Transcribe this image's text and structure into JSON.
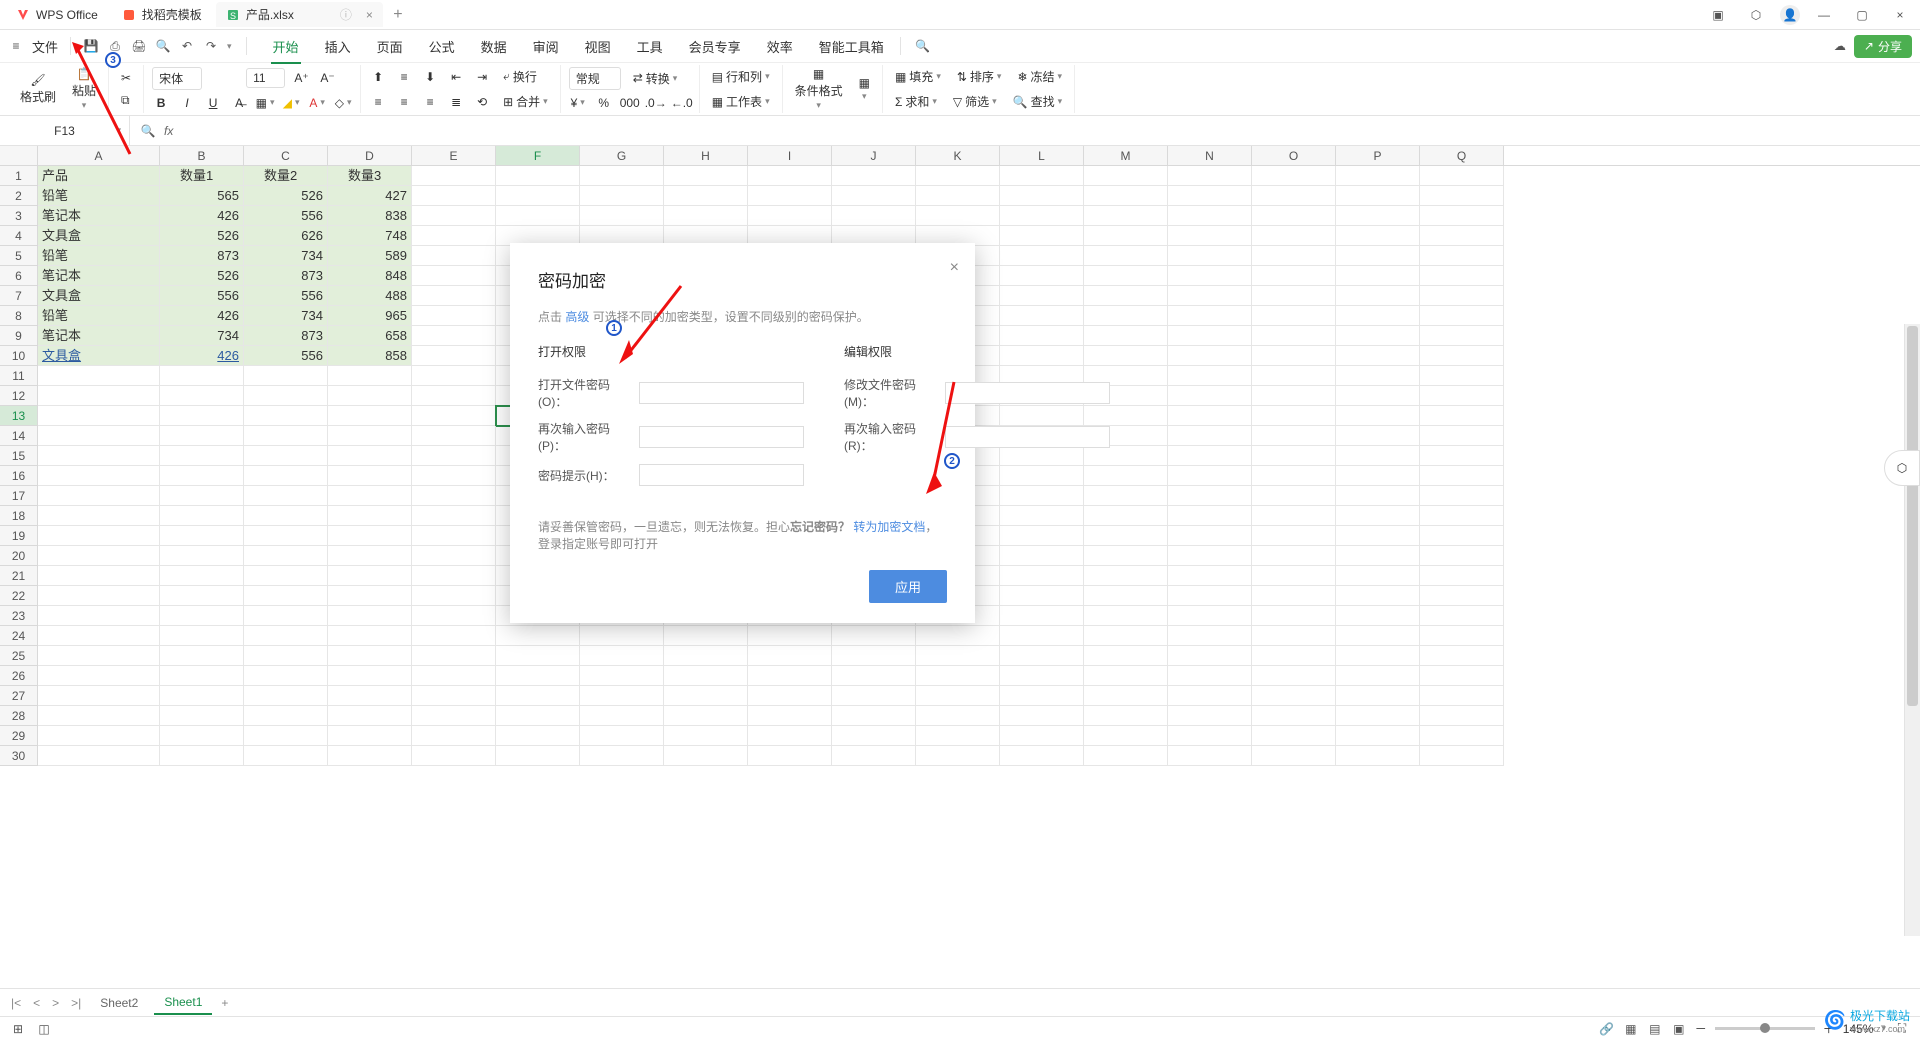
{
  "title_tabs": [
    {
      "icon_color": "#ff4d4d",
      "label": "WPS Office"
    },
    {
      "icon_color": "#ff5a3c",
      "label": "找稻壳模板"
    },
    {
      "icon_color": "#3cb371",
      "label": "产品.xlsx"
    }
  ],
  "quick": {
    "file": "文件"
  },
  "menu": [
    "开始",
    "插入",
    "页面",
    "公式",
    "数据",
    "审阅",
    "视图",
    "工具",
    "会员专享",
    "效率",
    "智能工具箱"
  ],
  "ribbon": {
    "format_brush": "格式刷",
    "paste": "粘贴",
    "font_name": "宋体",
    "font_size": "11",
    "wrap": "换行",
    "general": "常规",
    "convert": "转换",
    "rowcol": "行和列",
    "worksheet": "工作表",
    "cond_format": "条件格式",
    "fill": "填充",
    "sort": "排序",
    "freeze": "冻结",
    "sum": "求和",
    "filter": "筛选",
    "find": "查找",
    "merge": "合并"
  },
  "share_btn": "分享",
  "name_box": "F13",
  "fx": "fx",
  "columns": [
    "A",
    "B",
    "C",
    "D",
    "E",
    "F",
    "G",
    "H",
    "I",
    "J",
    "K",
    "L",
    "M",
    "N",
    "O",
    "P",
    "Q"
  ],
  "data_rows": [
    {
      "r": 1,
      "cells": [
        "产品",
        "数量1",
        "数量2",
        "数量3"
      ],
      "hl": true,
      "header": true
    },
    {
      "r": 2,
      "cells": [
        "铅笔",
        "565",
        "526",
        "427"
      ],
      "hl": true
    },
    {
      "r": 3,
      "cells": [
        "笔记本",
        "426",
        "556",
        "838"
      ],
      "hl": true
    },
    {
      "r": 4,
      "cells": [
        "文具盒",
        "526",
        "626",
        "748"
      ],
      "hl": true
    },
    {
      "r": 5,
      "cells": [
        "铅笔",
        "873",
        "734",
        "589"
      ],
      "hl": true
    },
    {
      "r": 6,
      "cells": [
        "笔记本",
        "526",
        "873",
        "848"
      ],
      "hl": true
    },
    {
      "r": 7,
      "cells": [
        "文具盒",
        "556",
        "556",
        "488"
      ],
      "hl": true
    },
    {
      "r": 8,
      "cells": [
        "铅笔",
        "426",
        "734",
        "965"
      ],
      "hl": true
    },
    {
      "r": 9,
      "cells": [
        "笔记本",
        "734",
        "873",
        "658"
      ],
      "hl": true
    },
    {
      "r": 10,
      "cells": [
        "文具盒",
        "426",
        "556",
        "858"
      ],
      "hl": true,
      "link_a": true,
      "link_b": true
    }
  ],
  "total_rows": 30,
  "active": {
    "col": "F",
    "row": 13
  },
  "dialog": {
    "title": "密码加密",
    "desc_pre": "点击 ",
    "desc_link": "高级",
    "desc_post": " 可选择不同的加密类型，设置不同级别的密码保护。",
    "left_title": "打开权限",
    "right_title": "编辑权限",
    "f_open": "打开文件密码(O)：",
    "f_open2": "再次输入密码(P)：",
    "f_hint": "密码提示(H)：",
    "f_mod": "修改文件密码(M)：",
    "f_mod2": "再次输入密码(R)：",
    "note_pre": "请妥善保管密码，一旦遗忘，则无法恢复。担心",
    "note_bold": "忘记密码？",
    "note_link": "转为加密文档",
    "note_post": "，登录指定账号即可打开",
    "apply": "应用"
  },
  "sheet_tabs": [
    "Sheet2",
    "Sheet1"
  ],
  "active_sheet": 1,
  "status": {
    "zoom": "145%"
  },
  "watermark": {
    "main": "极光下载站",
    "sub": "www.xz7.com"
  }
}
